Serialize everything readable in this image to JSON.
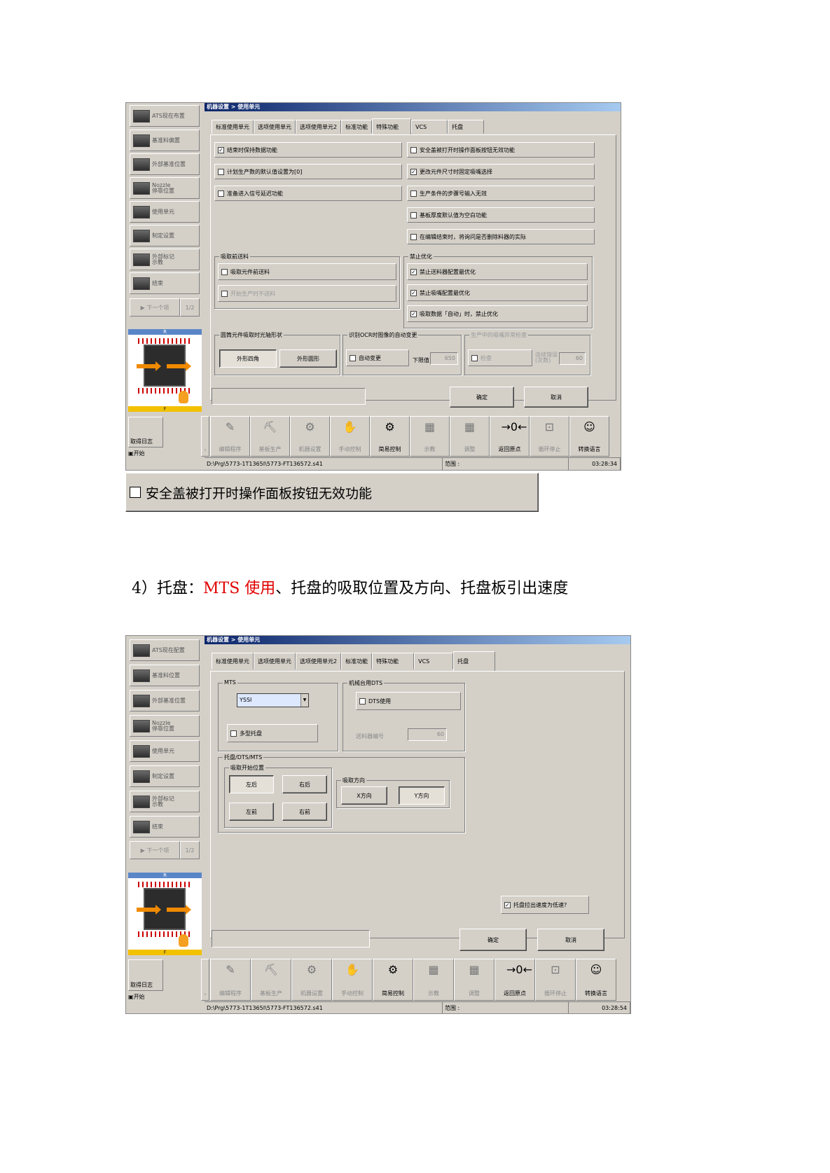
{
  "screen1": {
    "title": "机器设置 > 使用单元",
    "sidebar": [
      "ATS现在布置",
      "基准料偏置",
      "外部基准位置",
      "Nozzle\n停靠位置",
      "使用单元",
      "制定设置",
      "外部标记\n示教",
      "结束"
    ],
    "next_label": "下一个项",
    "page": "1/2",
    "machine_rear": "R",
    "machine_front": "F",
    "tabs": [
      "标准使用单元",
      "选项使用单元",
      "选项使用单元2",
      "标准功能",
      "特殊功能",
      "VCS",
      "托盘"
    ],
    "active_tab": 4,
    "left_checks": [
      {
        "label": "结束时保持数据功能",
        "checked": true
      },
      {
        "label": "计划生产数的默认值设置为[0]",
        "checked": false
      },
      {
        "label": "准备进入信号延迟功能",
        "checked": false
      }
    ],
    "right_checks": [
      {
        "label": "安全盖被打开时操作面板按钮无效功能",
        "checked": false
      },
      {
        "label": "更改元件尺寸时固定吸嘴选择",
        "checked": true
      },
      {
        "label": "生产条件的步骤号输入无效",
        "checked": false
      },
      {
        "label": "基板厚度默认值为空白功能",
        "checked": false
      },
      {
        "label": "在编辑结束时，将询问是否删除料器的实际",
        "checked": false
      }
    ],
    "group_pickup": {
      "title": "吸取前送料",
      "items": [
        {
          "label": "吸取元件前送料",
          "checked": false,
          "disabled": false
        },
        {
          "label": "开始生产时不送料",
          "checked": false,
          "disabled": true
        }
      ]
    },
    "group_forbid": {
      "title": "禁止优化",
      "items": [
        {
          "label": "禁止送料器配置最优化",
          "checked": true
        },
        {
          "label": "禁止吸嘴配置最优化",
          "checked": true
        },
        {
          "label": "吸取数据「自动」时，禁止优化",
          "checked": true
        }
      ]
    },
    "group_shape": {
      "title": "圆筒元件吸取时光轴形状",
      "btn1": "外形四角",
      "btn2": "外形圆形"
    },
    "group_ocr": {
      "title": "识别OCR时图像的自动变更",
      "check": "自动变更",
      "lower_label": "下限值",
      "lower_value": "650"
    },
    "group_check": {
      "title": "生产中的吸嘴异常检查",
      "check": "检查",
      "label": "连续错误\n(次数)",
      "value": "60"
    },
    "ok": "确定",
    "cancel": "取消",
    "taskbar": [
      {
        "label": "编辑程序",
        "icon": "✎",
        "en": false
      },
      {
        "label": "基板生产",
        "icon": "⛏",
        "en": false
      },
      {
        "label": "机器设置",
        "icon": "⚙",
        "en": false
      },
      {
        "label": "手动控制",
        "icon": "✋",
        "en": false
      },
      {
        "label": "简易控制",
        "icon": "⚙",
        "en": true
      },
      {
        "label": "示教",
        "icon": "▦",
        "en": false
      },
      {
        "label": "调整",
        "icon": "▦",
        "en": false
      },
      {
        "label": "返回原点",
        "icon": "→0←",
        "en": true
      },
      {
        "label": "循环停止",
        "icon": "⊡",
        "en": false
      },
      {
        "label": "转换语言",
        "icon": "☺",
        "en": true
      }
    ],
    "log_button": "取得日志",
    "start": "开始",
    "path": "D:\\Prg\\5773-1T1365I\\5773-FT136572.s41",
    "range_label": "范围 :",
    "time": "03:28:34"
  },
  "zoom_check": {
    "label": "安全盖被打开时操作面板按钮无效功能",
    "checked": false
  },
  "heading": {
    "prefix": "4）托盘：",
    "red": "MTS 使用",
    "suffix": "、托盘的吸取位置及方向、托盘板引出速度"
  },
  "screen2": {
    "title": "机器设置 > 使用单元",
    "sidebar": [
      "ATS现在配置",
      "基准料位置",
      "外部基准位置",
      "Nozzle\n停靠位置",
      "使用单元",
      "制定设置",
      "外部标记\n示教",
      "结束"
    ],
    "next_label": "下一个项",
    "page": "1/2",
    "machine_rear": "R",
    "machine_front": "F",
    "tabs": [
      "标准使用单元",
      "选项使用单元",
      "选项使用单元2",
      "标准功能",
      "特殊功能",
      "VCS",
      "托盘"
    ],
    "active_tab": 6,
    "group_mts": {
      "title": "MTS",
      "select": "YSSI",
      "multi": "多型托盘"
    },
    "group_dts": {
      "title": "机械台用DTS",
      "check": "DTS使用",
      "label": "送料器编号",
      "value": "60"
    },
    "group_tray": {
      "title": "托盘/DTS/MTS"
    },
    "group_pos": {
      "title": "吸取开始位置",
      "buttons": [
        "左后",
        "右后",
        "左前",
        "右前"
      ]
    },
    "group_dir": {
      "title": "吸取方向",
      "buttons": [
        "X方向",
        "Y方向"
      ]
    },
    "speed_check": {
      "label": "托盘拉出速度为低速?",
      "checked": true
    },
    "ok": "确定",
    "cancel": "取消",
    "taskbar": [
      {
        "label": "编辑程序",
        "icon": "✎",
        "en": false
      },
      {
        "label": "基板生产",
        "icon": "⛏",
        "en": false
      },
      {
        "label": "机器设置",
        "icon": "⚙",
        "en": false
      },
      {
        "label": "手动控制",
        "icon": "✋",
        "en": false
      },
      {
        "label": "简易控制",
        "icon": "⚙",
        "en": true
      },
      {
        "label": "示教",
        "icon": "▦",
        "en": false
      },
      {
        "label": "调整",
        "icon": "▦",
        "en": false
      },
      {
        "label": "返回原点",
        "icon": "→0←",
        "en": true
      },
      {
        "label": "循环停止",
        "icon": "⊡",
        "en": false
      },
      {
        "label": "转换语言",
        "icon": "☺",
        "en": true
      }
    ],
    "log_button": "取得日志",
    "start": "开始",
    "path": "D:\\Prg\\5773-1T1365I\\5773-FT136572.s41",
    "range_label": "范围 :",
    "time": "03:28:54"
  }
}
